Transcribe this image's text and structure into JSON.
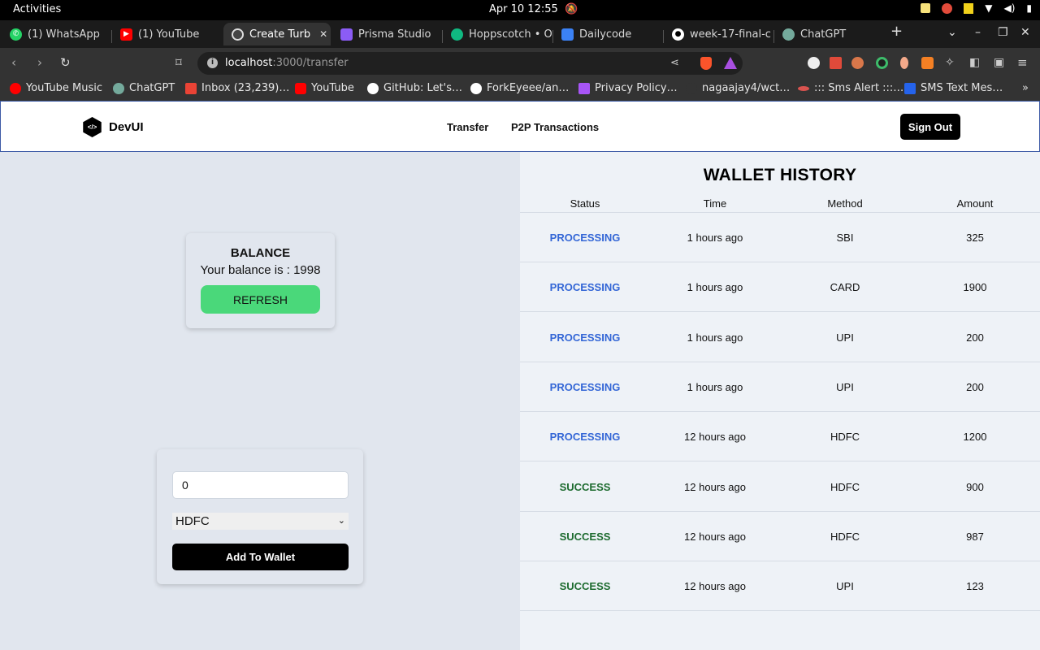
{
  "system": {
    "activities": "Activities",
    "clock": "Apr 10  12:55"
  },
  "tabs": [
    {
      "label": "(1) WhatsApp",
      "icon": "whatsapp-icon",
      "color": "#25d366"
    },
    {
      "label": "(1) YouTube",
      "icon": "youtube-icon",
      "color": "#ff0000"
    },
    {
      "label": "Create Turb",
      "icon": "turbo-icon",
      "color": "#555555",
      "active": true
    },
    {
      "label": "Prisma Studio",
      "icon": "prisma-icon",
      "color": "#8b5cf6"
    },
    {
      "label": "Hoppscotch • O",
      "icon": "hoppscotch-icon",
      "color": "#10b981"
    },
    {
      "label": "Dailycode",
      "icon": "dailycode-icon",
      "color": "#3b82f6"
    },
    {
      "label": "week-17-final-c",
      "icon": "github-icon",
      "color": "#ffffff"
    },
    {
      "label": "ChatGPT",
      "icon": "chatgpt-icon",
      "color": "#74aa9c"
    }
  ],
  "browser": {
    "url_host": "localhost",
    "url_path": ":3000/transfer"
  },
  "bookmarks": [
    {
      "label": "YouTube Music",
      "color": "#ff0000"
    },
    {
      "label": "ChatGPT",
      "color": "#74aa9c"
    },
    {
      "label": "Inbox (23,239)…",
      "color": "#ea4335"
    },
    {
      "label": "YouTube",
      "color": "#ff0000"
    },
    {
      "label": "GitHub: Let's…",
      "color": "#ffffff"
    },
    {
      "label": "ForkEyeee/an…",
      "color": "#ffffff"
    },
    {
      "label": "Privacy Policy…",
      "color": "#a855f7"
    },
    {
      "label": "nagaajay4/wct…",
      "color": "#333333"
    },
    {
      "label": "::: Sms Alert :::…",
      "color": "#d9534f"
    },
    {
      "label": "SMS Text Mes…",
      "color": "#2563eb"
    }
  ],
  "app": {
    "brand": "DevUI",
    "nav": [
      "Transfer",
      "P2P Transactions"
    ],
    "signout": "Sign Out"
  },
  "balance": {
    "title": "BALANCE",
    "text": "Your balance is : 1998",
    "refresh": "REFRESH"
  },
  "add_money": {
    "amount": "0",
    "method": "HDFC",
    "button": "Add To Wallet"
  },
  "history": {
    "title": "WALLET HISTORY",
    "columns": [
      "Status",
      "Time",
      "Method",
      "Amount"
    ],
    "rows": [
      {
        "status": "PROCESSING",
        "time": "1 hours ago",
        "method": "SBI",
        "amount": "325"
      },
      {
        "status": "PROCESSING",
        "time": "1 hours ago",
        "method": "CARD",
        "amount": "1900"
      },
      {
        "status": "PROCESSING",
        "time": "1 hours ago",
        "method": "UPI",
        "amount": "200"
      },
      {
        "status": "PROCESSING",
        "time": "1 hours ago",
        "method": "UPI",
        "amount": "200"
      },
      {
        "status": "PROCESSING",
        "time": "12 hours ago",
        "method": "HDFC",
        "amount": "1200"
      },
      {
        "status": "SUCCESS",
        "time": "12 hours ago",
        "method": "HDFC",
        "amount": "900"
      },
      {
        "status": "SUCCESS",
        "time": "12 hours ago",
        "method": "HDFC",
        "amount": "987"
      },
      {
        "status": "SUCCESS",
        "time": "12 hours ago",
        "method": "UPI",
        "amount": "123"
      }
    ]
  }
}
